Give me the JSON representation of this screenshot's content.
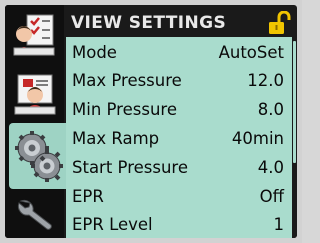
{
  "title": "VIEW SETTINGS",
  "tabs": [
    {
      "icon": "checklist-patient-icon"
    },
    {
      "icon": "patient-chart-icon"
    },
    {
      "icon": "gears-icon",
      "selected": true
    },
    {
      "icon": "wrench-icon"
    }
  ],
  "settings": [
    {
      "label": "Mode",
      "value": "AutoSet"
    },
    {
      "label": "Max Pressure",
      "value": "12.0"
    },
    {
      "label": "Min Pressure",
      "value": "8.0"
    },
    {
      "label": "Max Ramp",
      "value": "40min"
    },
    {
      "label": "Start Pressure",
      "value": "4.0"
    },
    {
      "label": "EPR",
      "value": "Off"
    },
    {
      "label": "EPR Level",
      "value": "1"
    }
  ],
  "colors": {
    "list_bg": "#a9dccd",
    "selected_tab": "#9ed3c4",
    "lock": "#f0c400"
  }
}
